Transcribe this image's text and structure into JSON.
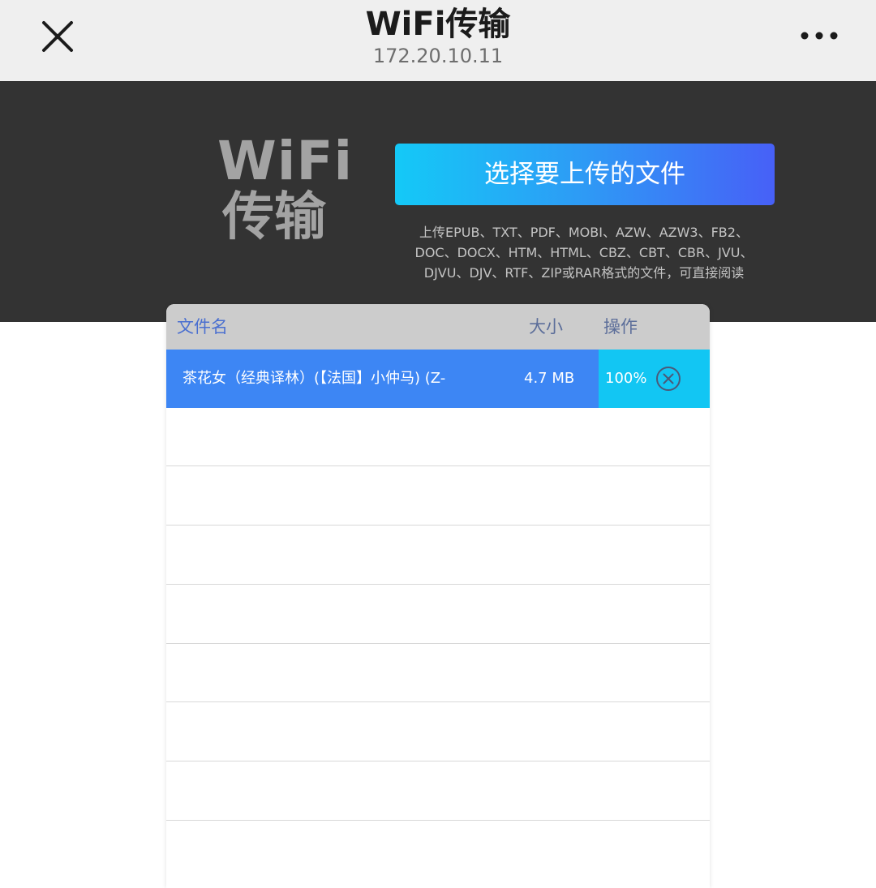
{
  "header": {
    "close_icon": "close-icon",
    "title": "WiFi传输",
    "subtitle": "172.20.10.11",
    "more_icon": "more-dots-icon"
  },
  "banner": {
    "logo_line1": "WiFi",
    "logo_line2": "传输",
    "upload_button": "选择要上传的文件",
    "formats_line1": "上传EPUB、TXT、PDF、MOBI、AZW、AZW3、FB2、",
    "formats_line2": "DOC、DOCX、HTM、HTML、CBZ、CBT、CBR、JVU、",
    "formats_line3": "DJVU、DJV、RTF、ZIP或RAR格式的文件，可直接阅读"
  },
  "table": {
    "columns": [
      "文件名",
      "大小",
      "操作"
    ],
    "rows": [
      {
        "name": "茶花女（经典译林）(【法国】小仲马) (Z-",
        "size": "4.7 MB",
        "progress": "100%",
        "action_icon": "cancel-circle-icon"
      }
    ]
  },
  "colors": {
    "topbar_bg": "#efefef",
    "banner_bg": "#333333",
    "row_active": "#3d86f4",
    "op_cell": "#12c6f3",
    "header_text": "#4a6fd0"
  }
}
